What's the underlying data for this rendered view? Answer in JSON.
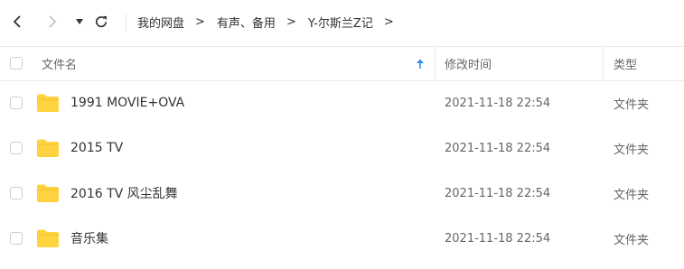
{
  "toolbar": {
    "breadcrumb": [
      "我的网盘",
      "有声、备用",
      "Y-尔斯兰Z记"
    ],
    "separator": ">"
  },
  "header": {
    "name_label": "文件名",
    "modified_label": "修改时间",
    "type_label": "类型"
  },
  "files": [
    {
      "name": "1991 MOVIE+OVA",
      "modified": "2021-11-18 22:54",
      "type": "文件夹"
    },
    {
      "name": "2015 TV",
      "modified": "2021-11-18 22:54",
      "type": "文件夹"
    },
    {
      "name": "2016 TV 风尘乱舞",
      "modified": "2021-11-18 22:54",
      "type": "文件夹"
    },
    {
      "name": "音乐集",
      "modified": "2021-11-18 22:54",
      "type": "文件夹"
    }
  ],
  "colors": {
    "folder": "#FFD23F",
    "sort_arrow": "#2E8CF0",
    "text": "#333333",
    "muted": "#666666"
  },
  "icons": [
    "back-icon",
    "forward-icon",
    "dropdown-caret-icon",
    "refresh-icon",
    "sort-ascending-icon",
    "folder-icon"
  ]
}
